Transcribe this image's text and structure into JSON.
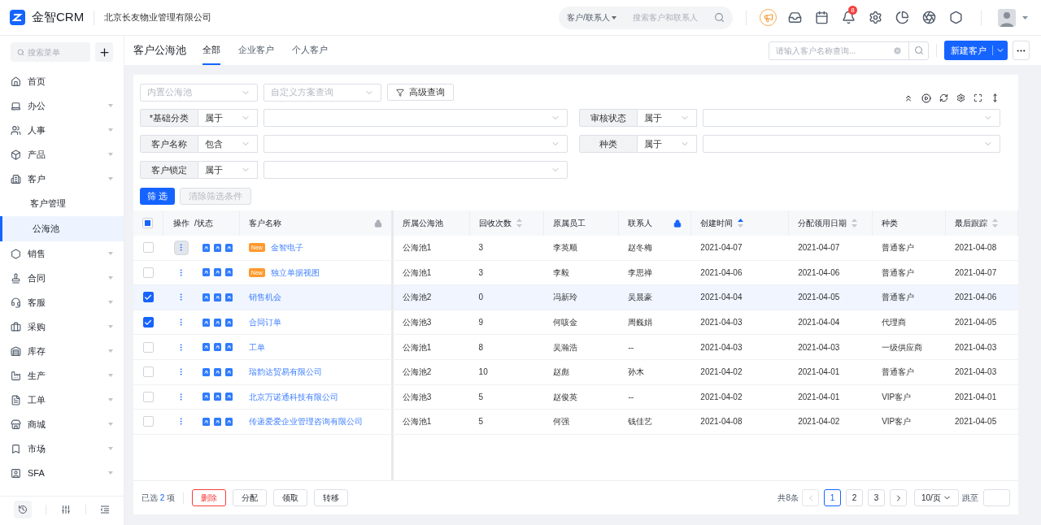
{
  "app": {
    "logo_text": "金智CRM",
    "company": "北京长友物业管理有限公司"
  },
  "header": {
    "search_scope": "客户/联系人",
    "search_placeholder": "搜索客户和联系人",
    "notification_count": "8"
  },
  "sidebar": {
    "search_placeholder": "搜索菜单",
    "items": [
      {
        "label": "首页",
        "collapsible": false,
        "selected": false
      },
      {
        "label": "办公",
        "collapsible": true,
        "selected": false
      },
      {
        "label": "人事",
        "collapsible": true,
        "selected": false
      },
      {
        "label": "产品",
        "collapsible": true,
        "selected": false
      },
      {
        "label": "客户",
        "collapsible": true,
        "selected": false,
        "children": [
          {
            "label": "客户管理",
            "selected": false
          },
          {
            "label": "公海池",
            "selected": true
          }
        ]
      },
      {
        "label": "销售",
        "collapsible": true,
        "selected": false
      },
      {
        "label": "合同",
        "collapsible": true,
        "selected": false
      },
      {
        "label": "客服",
        "collapsible": true,
        "selected": false
      },
      {
        "label": "采购",
        "collapsible": true,
        "selected": false
      },
      {
        "label": "库存",
        "collapsible": true,
        "selected": false
      },
      {
        "label": "生产",
        "collapsible": true,
        "selected": false
      },
      {
        "label": "工单",
        "collapsible": true,
        "selected": false
      },
      {
        "label": "商城",
        "collapsible": true,
        "selected": false
      },
      {
        "label": "市场",
        "collapsible": true,
        "selected": false
      },
      {
        "label": "SFA",
        "collapsible": true,
        "selected": false
      }
    ]
  },
  "page": {
    "title": "客户公海池",
    "tabs": [
      {
        "label": "全部",
        "selected": true
      },
      {
        "label": "企业客户",
        "selected": false
      },
      {
        "label": "个人客户",
        "selected": false
      }
    ],
    "name_search_placeholder": "请输入客户名称查询...",
    "new_button": "新建客户"
  },
  "filters": {
    "presets": [
      {
        "placeholder": "内置公海池"
      },
      {
        "placeholder": "自定义方案查询"
      }
    ],
    "advanced_button": "高级查询",
    "left": [
      {
        "label": "*基础分类",
        "operator": "属于"
      },
      {
        "label": "客户名称",
        "operator": "包含"
      },
      {
        "label": "客户锁定",
        "operator": "属于"
      }
    ],
    "right": [
      {
        "label": "审核状态",
        "operator": "属于"
      },
      {
        "label": "种类",
        "operator": "属于"
      }
    ],
    "apply_button": "筛 选",
    "clear_button": {
      "label": "清除筛选条件",
      "disabled": true
    }
  },
  "table": {
    "select_all": {
      "checked": false,
      "indeterminate": true
    },
    "fixed_columns": [
      {
        "label": "操作"
      },
      {
        "label": "/状态"
      },
      {
        "label": "客户名称",
        "locked": false
      }
    ],
    "columns": [
      {
        "label": "所属公海池"
      },
      {
        "label": "回收次数",
        "sortable": true,
        "sorted_ascending": false
      },
      {
        "label": "原属员工"
      },
      {
        "label": "联系人",
        "locked": true
      },
      {
        "label": "创建时间",
        "sortable": true,
        "sorted_ascending": true
      },
      {
        "label": "分配领用日期",
        "sortable": true,
        "sorted_ascending": false
      },
      {
        "label": "种类"
      },
      {
        "label": "最后跟踪",
        "sortable": true,
        "sorted_ascending": false
      }
    ],
    "rows": [
      {
        "checked": false,
        "hovered": false,
        "menu_hovered": true,
        "badge": "New",
        "name": "金智电子",
        "cells": [
          "公海池1",
          "3",
          "李英顺",
          "赵冬梅",
          "2021-04-07",
          "2021-04-07",
          "普通客户",
          "2021-04-08"
        ]
      },
      {
        "checked": false,
        "hovered": false,
        "menu_hovered": false,
        "badge": "New",
        "name": "独立单据视图",
        "cells": [
          "公海池1",
          "3",
          "李毅",
          "李思禅",
          "2021-04-06",
          "2021-04-06",
          "普通客户",
          "2021-04-07"
        ]
      },
      {
        "checked": true,
        "hovered": true,
        "menu_hovered": false,
        "name": "销售机会",
        "cells": [
          "公海池2",
          "0",
          "冯新玲",
          "吴晨豪",
          "2021-04-04",
          "2021-04-05",
          "普通客户",
          "2021-04-06"
        ]
      },
      {
        "checked": true,
        "hovered": false,
        "menu_hovered": false,
        "name": "合同订单",
        "cells": [
          "公海池3",
          "9",
          "何咳金",
          "周巍娟",
          "2021-04-03",
          "2021-04-04",
          "代理商",
          "2021-04-05"
        ]
      },
      {
        "checked": false,
        "hovered": false,
        "menu_hovered": false,
        "name": "工单",
        "cells": [
          "公海池1",
          "8",
          "吴瀚浩",
          "--",
          "2021-04-03",
          "2021-04-03",
          "一级供应商",
          "2021-04-03"
        ]
      },
      {
        "checked": false,
        "hovered": false,
        "menu_hovered": false,
        "name": "瑞韵达贸易有限公司",
        "cells": [
          "公海池2",
          "10",
          "赵彪",
          "孙木",
          "2021-04-02",
          "2021-04-01",
          "普通客户",
          "2021-04-03"
        ]
      },
      {
        "checked": false,
        "hovered": false,
        "menu_hovered": false,
        "name": "北京万诺通科技有限公司",
        "cells": [
          "公海池3",
          "5",
          "赵俊英",
          "--",
          "2021-04-02",
          "2021-04-01",
          "VIP客户",
          "2021-04-01"
        ]
      },
      {
        "checked": false,
        "hovered": false,
        "menu_hovered": false,
        "name": "传递爱爱企业管理咨询有限公司",
        "cells": [
          "公海池1",
          "5",
          "何强",
          "钱佳艺",
          "2021-04-08",
          "2021-04-02",
          "VIP客户",
          "2021-04-05"
        ]
      }
    ]
  },
  "footer": {
    "selection": {
      "prefix": "已选",
      "count": "2",
      "suffix": "项"
    },
    "actions": [
      {
        "label": "删除",
        "kind": "danger"
      },
      {
        "label": "分配",
        "kind": "default"
      },
      {
        "label": "领取",
        "kind": "default"
      },
      {
        "label": "转移",
        "kind": "default"
      }
    ],
    "total": "共8条",
    "prev_disabled": true,
    "pages": [
      {
        "label": "1",
        "selected": true
      },
      {
        "label": "2",
        "selected": false
      },
      {
        "label": "3",
        "selected": false
      }
    ],
    "page_size": "10/页",
    "jump_label": "跳至"
  }
}
